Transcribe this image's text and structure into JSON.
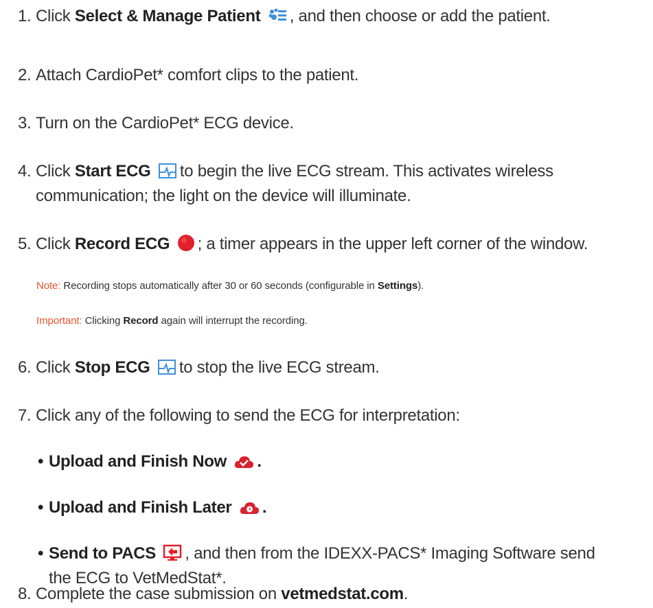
{
  "steps": [
    {
      "num": "1.",
      "pre": "Click ",
      "bold": "Select & Manage Patient",
      "post": ", and then choose or add the patient."
    },
    {
      "num": "2.",
      "text": "Attach CardioPet* comfort clips to the patient."
    },
    {
      "num": "3.",
      "text": "Turn on the CardioPet* ECG device."
    },
    {
      "num": "4.",
      "pre": "Click ",
      "bold": "Start ECG",
      "post": "to begin the live ECG stream. This activates wireless",
      "line2": "communication; the light on the device will illuminate."
    },
    {
      "num": "5.",
      "pre": "Click ",
      "bold": "Record ECG",
      "post": "; a timer appears in the upper left corner of the window."
    },
    {
      "num": "6.",
      "pre": "Click ",
      "bold": "Stop ECG",
      "post": "to stop the live ECG stream."
    },
    {
      "num": "7.",
      "text": "Click any of the following to send the ECG for interpretation:"
    },
    {
      "num": "8.",
      "pre": "Complete the case submission on ",
      "bold": "vetmedstat.com",
      "post": "."
    }
  ],
  "notes": [
    {
      "label": "Note:",
      "pre": " Recording stops automatically after 30 or 60 seconds (configurable in ",
      "bold": "Settings",
      "post": ")."
    },
    {
      "label": "Important:",
      "pre": " Clicking ",
      "bold": "Record",
      "post": " again will interrupt the recording."
    }
  ],
  "bullets": [
    {
      "dot": "•",
      "bold": "Upload and Finish Now",
      "post": "."
    },
    {
      "dot": "•",
      "bold": "Upload and Finish Later",
      "post": "."
    },
    {
      "dot": "•",
      "bold": "Send to PACS",
      "post": ", and then from the IDEXX-PACS* Imaging Software send",
      "line2": "the ECG to VetMedStat*."
    }
  ],
  "icons": {
    "select_manage_patient": "patient-list-icon",
    "start_ecg": "ecg-monitor-icon",
    "record_ecg": "record-dot-icon",
    "stop_ecg": "ecg-monitor-icon",
    "upload_finish_now": "cloud-check-icon",
    "upload_finish_later": "cloud-clock-icon",
    "send_to_pacs": "pacs-send-icon"
  },
  "colors": {
    "text": "#333333",
    "note_label": "#e8542e",
    "icon_blue": "#3f8fd8",
    "icon_red": "#e0202a",
    "cloud_red": "#d9222e"
  }
}
